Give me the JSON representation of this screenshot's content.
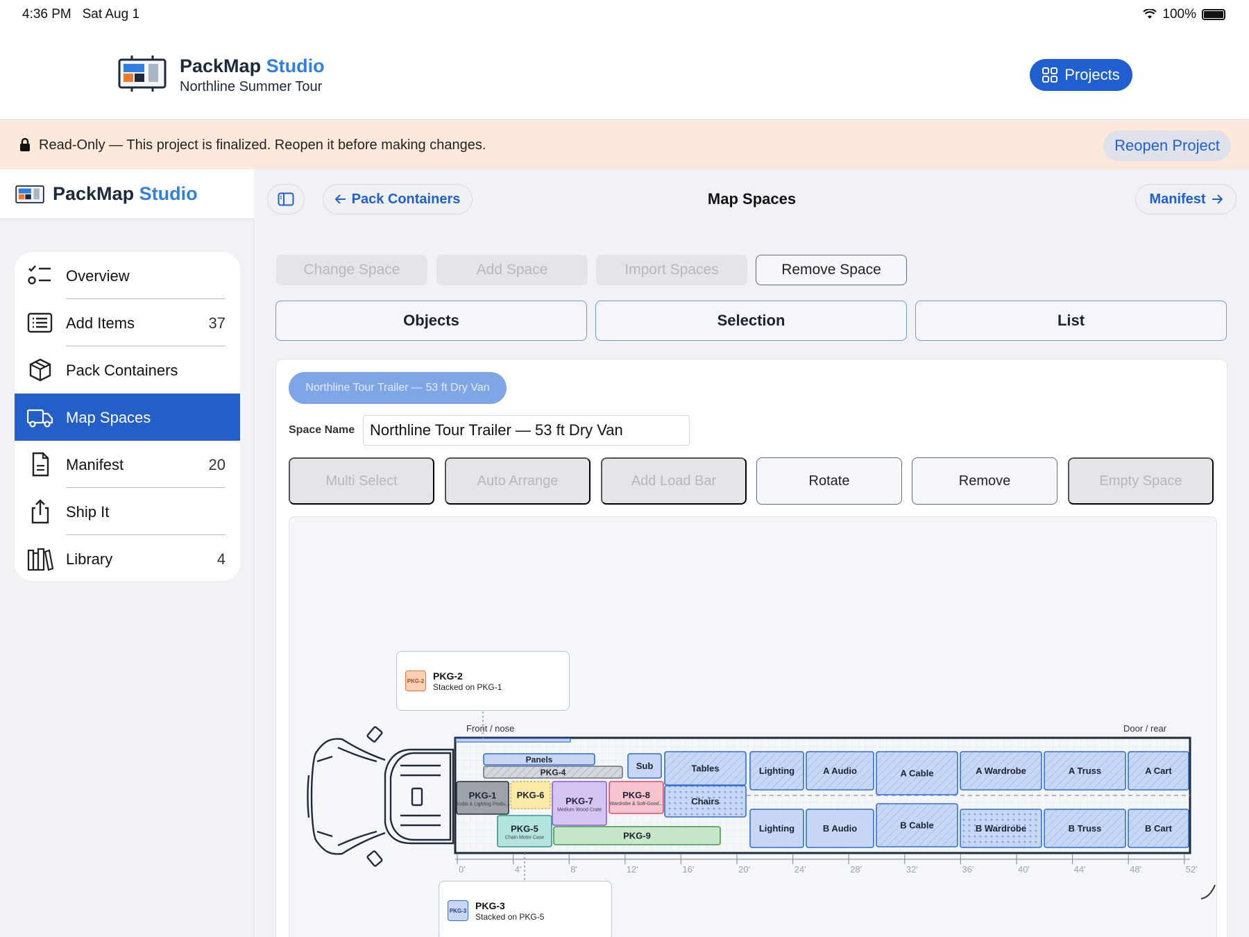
{
  "status": {
    "time": "4:36 PM",
    "date": "Sat Aug 1",
    "battery": "100%"
  },
  "app": {
    "name": "PackMap",
    "name_accent": "Studio",
    "project": "Northline Summer Tour",
    "projects_label": "Projects"
  },
  "banner": {
    "message": "Read-Only — This project is finalized. Reopen it before making changes.",
    "reopen_label": "Reopen Project"
  },
  "sidebar": {
    "items": [
      {
        "label": "Overview",
        "count": "",
        "icon": "checklist-icon"
      },
      {
        "label": "Add Items",
        "count": "37",
        "icon": "list-icon"
      },
      {
        "label": "Pack Containers",
        "count": "",
        "icon": "box-icon"
      },
      {
        "label": "Map Spaces",
        "count": "",
        "icon": "truck-icon",
        "active": true
      },
      {
        "label": "Manifest",
        "count": "20",
        "icon": "document-icon"
      },
      {
        "label": "Ship It",
        "count": "",
        "icon": "share-icon"
      },
      {
        "label": "Library",
        "count": "4",
        "icon": "books-icon"
      }
    ]
  },
  "toolbar": {
    "back_label": "Pack Containers",
    "title": "Map Spaces",
    "forward_label": "Manifest"
  },
  "actions": {
    "change": "Change Space",
    "add": "Add Space",
    "import": "Import Spaces",
    "remove": "Remove Space"
  },
  "tabs": {
    "objects": "Objects",
    "selection": "Selection",
    "list": "List"
  },
  "space": {
    "chip": "Northline Tour Trailer — 53 ft Dry Van",
    "name_label": "Space Name",
    "name_value": "Northline Tour Trailer — 53 ft Dry Van"
  },
  "tools": {
    "multi": "Multi Select",
    "auto": "Auto Arrange",
    "loadbar": "Add Load Bar",
    "rotate": "Rotate",
    "remove": "Remove",
    "empty": "Empty Space"
  },
  "map": {
    "front_label": "Front / nose",
    "rear_label": "Door / rear",
    "tick_labels": [
      "0'",
      "4'",
      "8'",
      "12'",
      "16'",
      "20'",
      "24'",
      "28'",
      "32'",
      "36'",
      "40'",
      "44'",
      "48'",
      "52'"
    ],
    "callout_top": {
      "badge": "PKG-2",
      "title": "PKG-2",
      "sub": "Stacked on PKG-1"
    },
    "callout_bottom": {
      "badge": "PKG-3",
      "title": "PKG-3",
      "sub": "Stacked on PKG-5"
    },
    "items": [
      {
        "label": "Panels"
      },
      {
        "label": "PKG-4"
      },
      {
        "label": "Sub"
      },
      {
        "label": "Tables"
      },
      {
        "label": "Chairs"
      },
      {
        "label": "PKG-1",
        "sub": "Audio & Lighting Produ..."
      },
      {
        "label": "PKG-6"
      },
      {
        "label": "PKG-7",
        "sub": "Medium Wood Crate"
      },
      {
        "label": "PKG-8",
        "sub": "Wardrobe & Soft-Good..."
      },
      {
        "label": "PKG-5",
        "sub": "Chain Motor Case"
      },
      {
        "label": "PKG-9"
      },
      {
        "label": "Lighting"
      },
      {
        "label": "A Audio"
      },
      {
        "label": "A Cable"
      },
      {
        "label": "A Wardrobe"
      },
      {
        "label": "A Truss"
      },
      {
        "label": "A Cart"
      },
      {
        "label": "Lighting"
      },
      {
        "label": "B Audio"
      },
      {
        "label": "B Cable"
      },
      {
        "label": "B Wardrobe"
      },
      {
        "label": "B Truss"
      },
      {
        "label": "B Cart"
      }
    ]
  }
}
